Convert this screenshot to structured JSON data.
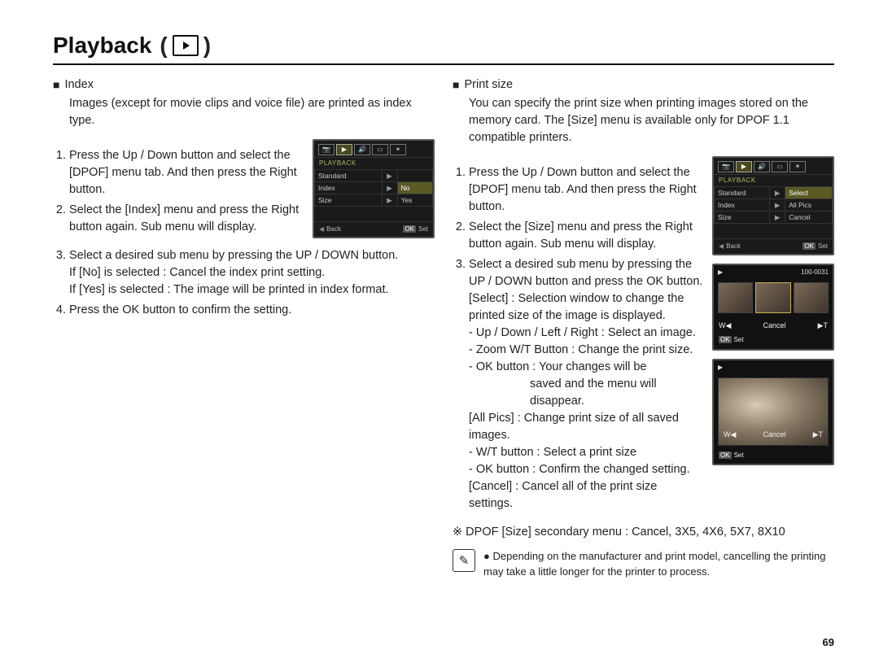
{
  "page": {
    "title": "Playback",
    "number": "69"
  },
  "left": {
    "heading": "Index",
    "intro": "Images (except for movie clips and voice file) are printed as index type.",
    "steps": {
      "s1": "Press the Up / Down button and select the [DPOF] menu tab. And then press the Right button.",
      "s2": "Select the [Index] menu and press the Right button again. Sub menu will display.",
      "s3": "Select a desired sub menu by pressing the UP / DOWN button.",
      "s3a": "If [No] is selected   : Cancel the index print setting.",
      "s3b": "If [Yes] is selected : The image will be printed in index format.",
      "s4": "Press the OK button to confirm the setting."
    },
    "lcd": {
      "label": "PLAYBACK",
      "rows": [
        {
          "left": "Standard",
          "right": ""
        },
        {
          "left": "Index",
          "right": "No"
        },
        {
          "left": "Size",
          "right": "Yes"
        }
      ],
      "foot_back": "Back",
      "foot_set": "Set"
    }
  },
  "right": {
    "heading": "Print size",
    "intro": "You can specify the print size when printing images stored on the memory card. The [Size] menu is available only for DPOF 1.1 compatible printers.",
    "steps": {
      "s1": "Press the Up / Down button and select the [DPOF] menu tab. And then press the Right button.",
      "s2": "Select the [Size] menu and press the Right button again. Sub menu will display.",
      "s3": "Select a desired sub menu by pressing the UP / DOWN button and press the OK button.",
      "select_label": "[Select] :",
      "select_desc": "Selection window to change the printed size of the image is displayed.",
      "opt_udlr": "- Up / Down / Left / Right : Select an image.",
      "opt_zoom": "- Zoom W/T Button : Change the print size.",
      "opt_ok": "- OK button : Your changes will be",
      "opt_ok2": "saved and the menu will disappear.",
      "allpics_label": "[All Pics] :",
      "allpics_desc": "Change print size of all saved images.",
      "ap_wt": "- W/T button : Select a print size",
      "ap_ok": "- OK button : Confirm the changed setting.",
      "cancel_label": "[Cancel] :",
      "cancel_desc": "Cancel all of the print size settings."
    },
    "lcd": {
      "label": "PLAYBACK",
      "rows": [
        {
          "left": "Standard",
          "right": "Select"
        },
        {
          "left": "Index",
          "right": "All Pics"
        },
        {
          "left": "Size",
          "right": "Cancel"
        }
      ],
      "foot_back": "Back",
      "foot_set": "Set"
    },
    "photo1": {
      "counter": "100-0031",
      "w": "W◀",
      "cancel": "Cancel",
      "t": "▶T",
      "set": "Set"
    },
    "photo2": {
      "w": "W◀",
      "cancel": "Cancel",
      "t": "▶T",
      "set": "Set"
    },
    "dpof_note": "※ DPOF [Size] secondary menu : Cancel, 3X5, 4X6, 5X7, 8X10",
    "footnote": "Depending on the manufacturer and print model, cancelling the printing may take a little longer for the printer to process."
  },
  "icons": {
    "camera": "📷",
    "play": "▶",
    "sound": "🔊",
    "display": "▭",
    "gear": "✶",
    "pencil": "✎"
  }
}
